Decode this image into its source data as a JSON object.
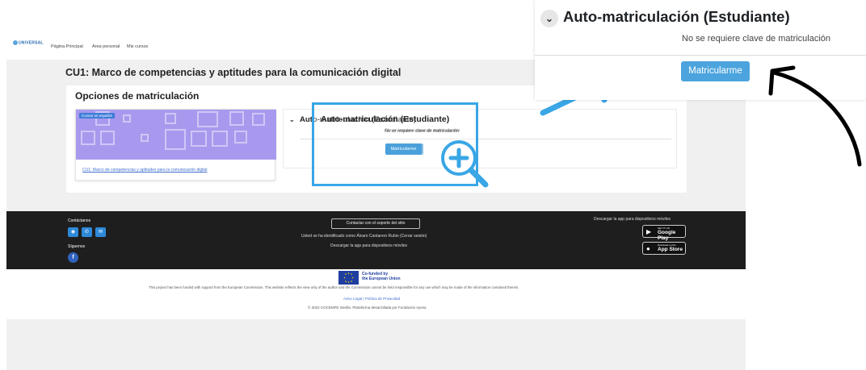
{
  "site": {
    "logo_text": "UNIVERSAL",
    "nav": [
      "Página Principal",
      "Área personal",
      "Mis cursos"
    ]
  },
  "course": {
    "title": "CU1: Marco de competencias y aptitudes para la comunicación digital",
    "section_title": "Opciones de matriculación",
    "category_badge": "Cursos en español",
    "card_link": "CU1: Marco de competencias y aptitudes para la comunicación digital"
  },
  "enrol": {
    "method_title": "Auto-matriculación (Estudiante)",
    "no_key_text": "No se requiere clave de matriculación",
    "button_label": "Matricularme"
  },
  "footer": {
    "contact_heading": "Contáctanos",
    "follow_heading": "Síguenos",
    "support_button": "Contactar con el soporte del sitio",
    "identified_text": "Usted se ha identificado como Álvaro Cantarero Rubio (Cerrar sesión)",
    "app_text": "Descargar la app para dispositivos móviles",
    "app_heading": "Descargar la app para dispositivos móviles",
    "google_small": "GET IT ON",
    "google_big": "Google Play",
    "apple_small": "Download on the",
    "apple_big": "App Store"
  },
  "eu": {
    "cofunded_line1": "Co-funded by",
    "cofunded_line2": "the European Union",
    "funded_text": "This project has been funded with support from the European Commission. This website reflects the view only of the author and the Commission cannot be held responsible for any use which may be made of the information contained therein.",
    "legal_links": "Aviso Legal | Política de Privacidad",
    "copyright": "© 2022 COCEMFE Sevilla. Plataforma desarrollada por Fundación Ayesa"
  },
  "colors": {
    "accent_blue": "#39a6e6",
    "button_blue": "#4aa0da",
    "course_image": "#a899ee",
    "footer_bg": "#1e1e1e"
  },
  "icons": [
    "chevron-down-icon",
    "whatsapp-icon",
    "phone-icon",
    "email-icon",
    "facebook-icon",
    "magnifier-plus-icon",
    "arrow-icon",
    "google-play-icon",
    "apple-icon"
  ]
}
